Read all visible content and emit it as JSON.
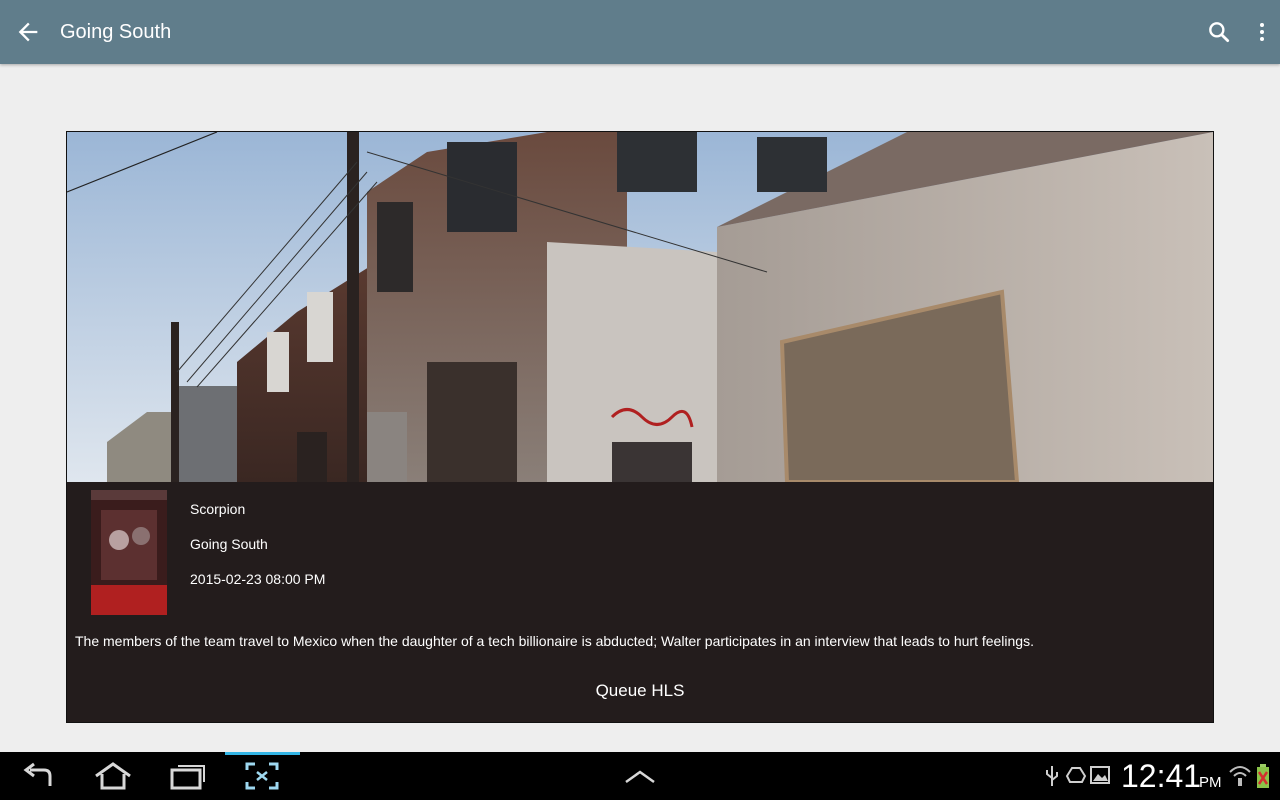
{
  "app_bar": {
    "title": "Going South",
    "color": "#607d8b",
    "icons": [
      "back-arrow-icon",
      "search-icon",
      "more-vert-icon"
    ]
  },
  "program": {
    "show": "Scorpion",
    "episode": "Going South",
    "air_time": "2015-02-23 08:00 PM",
    "description": "The members of the team travel to Mexico when the daughter of a tech billionaire is abducted; Walter participates in an interview that leads to hurt feelings.",
    "queue_label": "Queue HLS"
  },
  "system_bar": {
    "time": "12:41",
    "ampm": "PM",
    "accent": "#33b5e5",
    "icons": [
      "nav-back-icon",
      "nav-home-icon",
      "nav-recents-icon",
      "screenshot-icon",
      "nav-up-chevron-icon",
      "usb-icon",
      "recycle-icon",
      "image-icon",
      "wifi-icon",
      "battery-icon"
    ]
  }
}
